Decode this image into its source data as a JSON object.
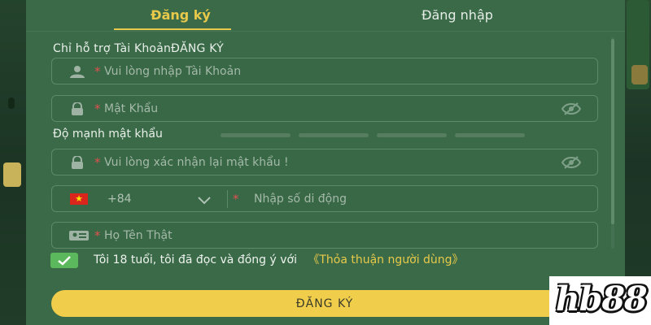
{
  "tabs": {
    "register": "Đăng ký",
    "login": "Đăng nhập"
  },
  "support_note": "Chỉ hỗ trợ Tài KhoảnĐĂNG KÝ",
  "form": {
    "required_mark": "*",
    "username": {
      "placeholder": "Vui lòng nhập Tài Khoản",
      "icon": "user-icon"
    },
    "password": {
      "placeholder": "Mật Khẩu",
      "icon": "lock-icon",
      "toggle_icon": "eye-off-icon"
    },
    "strength": {
      "label": "Độ mạnh mật khẩu",
      "level": 0,
      "segments": 4
    },
    "confirm_password": {
      "placeholder": "Vui lòng xác nhận lại mật khẩu !",
      "icon": "lock-icon",
      "toggle_icon": "eye-off-icon"
    },
    "phone": {
      "country_flag": "vietnam-flag-icon",
      "country_code": "+84",
      "placeholder": "Nhập số di động"
    },
    "real_name": {
      "placeholder": "Họ Tên Thật",
      "icon": "id-card-icon"
    }
  },
  "agreement": {
    "checked": true,
    "text": "Tôi 18 tuổi, tôi đã đọc và đồng ý với",
    "link": "《Thỏa thuận người dùng》"
  },
  "submit_label": "ĐĂNG KÝ",
  "watermark": "hb88",
  "colors": {
    "accent": "#e8c94a",
    "required": "#e05050",
    "panel": "#3a6a48",
    "checkbox": "#5cb85c",
    "button": "#f0ce4b"
  }
}
